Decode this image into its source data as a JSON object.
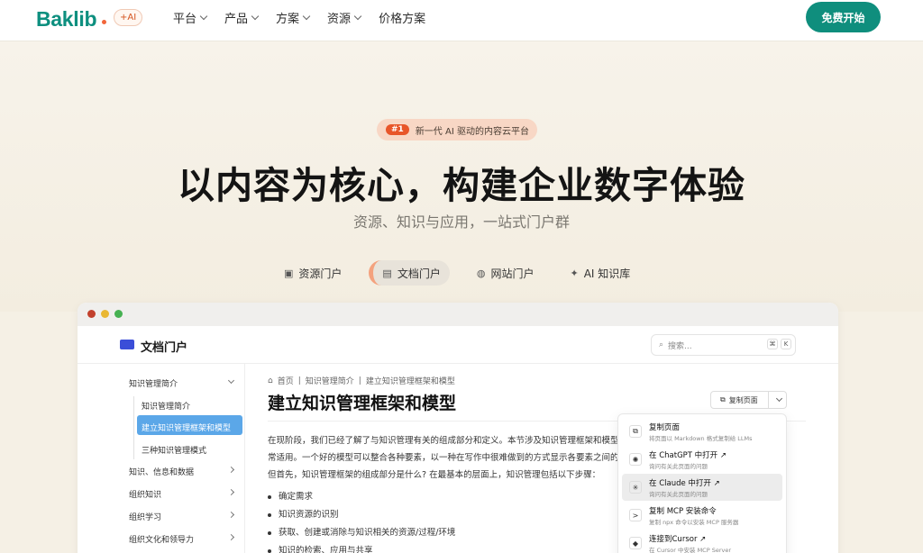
{
  "brand": {
    "name": "Baklib",
    "ai_badge": "+AI"
  },
  "nav": {
    "items": [
      "平台",
      "产品",
      "方案",
      "资源",
      "价格方案"
    ],
    "cta": "免费开始"
  },
  "hero": {
    "pill_number": "#1",
    "pill_text": "新一代 AI 驱动的内容云平台",
    "title": "以内容为核心，构建企业数字体验",
    "subtitle": "资源、知识与应用，一站式门户群"
  },
  "tabs": [
    {
      "label": "资源门户",
      "icon": "resource-icon"
    },
    {
      "label": "文档门户",
      "icon": "doc-icon"
    },
    {
      "label": "网站门户",
      "icon": "globe-icon"
    },
    {
      "label": "AI 知识库",
      "icon": "ai-icon"
    }
  ],
  "colors": {
    "brand": "#0d8f7f",
    "accent": "#e8562a",
    "active_item": "#5ba7e8"
  },
  "doc": {
    "portal_title": "文档门户",
    "search": {
      "placeholder": "搜索...",
      "kbd1": "⌘",
      "kbd2": "K"
    },
    "sidebar": [
      {
        "label": "知识管理简介"
      },
      {
        "label": "知识管理简介"
      },
      {
        "label": "建立知识管理框架和模型"
      },
      {
        "label": "三种知识管理模式"
      },
      {
        "label": "知识、信息和数据"
      },
      {
        "label": "组织知识"
      },
      {
        "label": "组织学习"
      },
      {
        "label": "组织文化和领导力"
      }
    ],
    "breadcrumb": [
      "首页",
      "知识管理简介",
      "建立知识管理框架和模型"
    ],
    "page_title": "建立知识管理框架和模型",
    "paragraphs": [
      "在现阶段，我们已经了解了与知识管理有关的组成部分和定义。本节涉及知识管理框架和模型",
      "常适用。一个好的模型可以整合各种要素，以一种在写作中很难做到的方式显示各要素之间的",
      "但首先，知识管理框架的组成部分是什么? 在最基本的层面上，知识管理包括以下步骤："
    ],
    "bullets": [
      "确定需求",
      "知识资源的识别",
      "获取、创建或消除与知识相关的资源/过程/环境",
      "知识的检索、应用与共享"
    ],
    "copy_button": "复制页面",
    "menu": [
      {
        "title": "复制页面",
        "sub": "将页面以 Markdown 格式复制给 LLMs",
        "icon": "copy-icon"
      },
      {
        "title": "在 ChatGPT 中打开 ↗",
        "sub": "询问有关此页面的问题",
        "icon": "chatgpt-icon"
      },
      {
        "title": "在 Claude 中打开 ↗",
        "sub": "询问有关此页面的问题",
        "icon": "claude-icon"
      },
      {
        "title": "复制 MCP 安装命令",
        "sub": "复制 npx 命令以安装 MCP 服务器",
        "icon": "terminal-icon"
      },
      {
        "title": "连接到Cursor ↗",
        "sub": "在 Cursor 中安装 MCP Server",
        "icon": "cursor-icon"
      }
    ]
  }
}
